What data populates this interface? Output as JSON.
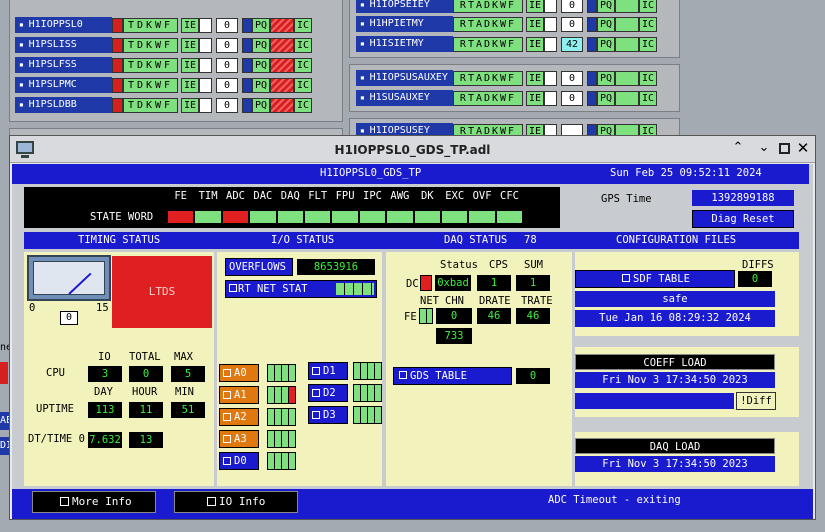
{
  "background_rows_left": [
    {
      "name": "H1IOPPSL0",
      "value": "0"
    },
    {
      "name": "H1PSLISS",
      "value": "0"
    },
    {
      "name": "H1PSLFSS",
      "value": "0"
    },
    {
      "name": "H1PSLPMC",
      "value": "0"
    },
    {
      "name": "H1PSLDBB",
      "value": "0"
    }
  ],
  "background_rows_right": [
    {
      "name": "H1IOPSEIEY",
      "value": "0"
    },
    {
      "name": "H1HPIETMY",
      "value": "0"
    },
    {
      "name": "H1ISIETMY",
      "value": "42"
    },
    {
      "name": "H1IOPSUSAUXEY",
      "value": "0"
    },
    {
      "name": "H1SUSAUXEY",
      "value": "0"
    },
    {
      "name": "H1IOPSUSEY",
      "value": ""
    }
  ],
  "status_letters": "TDKWF",
  "status_letters_right": "RTADKWF",
  "ie_label": "IE",
  "pq_label": "PQ",
  "ic_label": "IC",
  "side_partial_labels": [
    "ne",
    "AE",
    "DI"
  ],
  "window": {
    "title": "H1IOPPSL0_GDS_TP.adl",
    "header_name": "H1IOPPSL0_GDS_TP",
    "datetime": "Sun Feb 25 09:52:11 2024"
  },
  "state_word": {
    "label": "STATE WORD",
    "bits": [
      "FE",
      "TIM",
      "ADC",
      "DAC",
      "DAQ",
      "FLT",
      "FPU",
      "IPC",
      "AWG",
      "DK",
      "EXC",
      "OVF",
      "CFC"
    ],
    "states": [
      "red",
      "green",
      "red",
      "green",
      "green",
      "green",
      "green",
      "green",
      "green",
      "green",
      "green",
      "green",
      "green"
    ]
  },
  "gps": {
    "label": "GPS Time",
    "value": "1392899188",
    "diag_reset": "Diag Reset"
  },
  "sections": {
    "timing": "TIMING STATUS",
    "io": "I/O STATUS",
    "daq": "DAQ STATUS",
    "daq_num": "78",
    "config": "CONFIGURATION FILES"
  },
  "timing": {
    "ltds": "LTDS",
    "gauge_min": "0",
    "gauge_max": "15",
    "gauge_value": "0",
    "gauge_level": 0.13,
    "cpu_label": "CPU",
    "col_io": "IO",
    "col_total": "TOTAL",
    "col_max": "MAX",
    "cpu_io": "3",
    "cpu_total": "0",
    "cpu_max": "5",
    "uptime_label": "UPTIME",
    "col_day": "DAY",
    "col_hour": "HOUR",
    "col_min": "MIN",
    "up_day": "113",
    "up_hour": "11",
    "up_min": "51",
    "dt_label": "DT/TIME 0",
    "dt_val1": "7.632",
    "dt_val2": "13"
  },
  "io": {
    "overflows_label": "OVERFLOWS",
    "overflows_value": "8653916",
    "rtnet_label": "RT NET STAT",
    "adc_buttons": [
      "A0",
      "A1",
      "A2",
      "A3",
      "D0"
    ],
    "dac_buttons": [
      "D1",
      "D2",
      "D3"
    ]
  },
  "daq": {
    "status_label": "Status",
    "cps_label": "CPS",
    "sum_label": "SUM",
    "dc_label": "DC",
    "status_value": "0xbad",
    "cps_value": "1",
    "sum_value": "1",
    "net_label": "NET",
    "chn_label": "CHN",
    "drate_label": "DRATE",
    "trate_label": "TRATE",
    "fe_label": "FE",
    "chn_value": "0",
    "drate_value": "46",
    "trate_value": "46",
    "extra_value": "733",
    "gds_table_label": "GDS TABLE",
    "gds_table_value": "0"
  },
  "config": {
    "sdf_label": "SDF TABLE",
    "diffs_label": "DIFFS",
    "diffs_value": "0",
    "safe": "safe",
    "sdf_date": "Tue Jan 16 08:29:32 2024",
    "coeff_label": "COEFF LOAD",
    "coeff_date": "Fri Nov  3 17:34:50 2023",
    "diff_button": "!Diff",
    "daq_load_label": "DAQ LOAD",
    "daq_load_date": "Fri Nov  3 17:34:50 2023"
  },
  "footer": {
    "more_info": "More Info",
    "io_info": "IO Info",
    "message": "ADC Timeout - exiting"
  },
  "colors": {
    "blue": "#1a1acf",
    "red": "#d62020",
    "green": "#7fe07f",
    "orange": "#e07810",
    "yellow_panel": "#f2f2bd"
  }
}
